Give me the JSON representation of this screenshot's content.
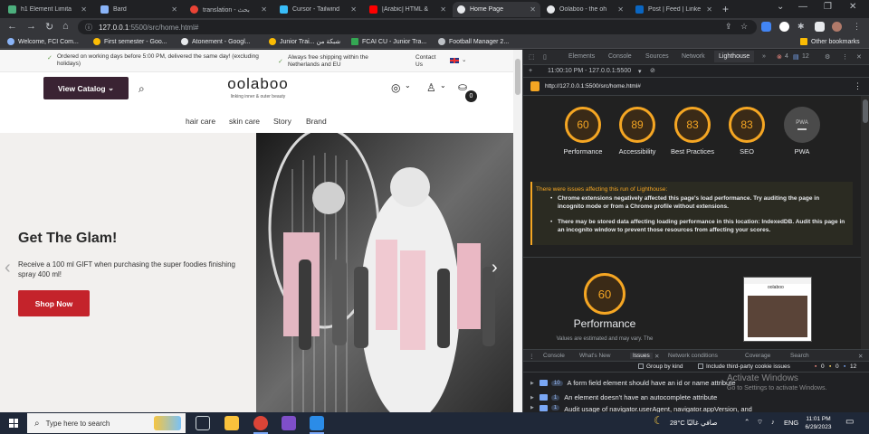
{
  "browser": {
    "tabs": [
      {
        "title": "h1 Element Limita",
        "color": "#4caf7d"
      },
      {
        "title": "Bard",
        "color": "#8ab4f8"
      },
      {
        "title": "translation - بحث",
        "color": "#ea4335"
      },
      {
        "title": "Cursor - Tailwind",
        "color": "#38bdf8"
      },
      {
        "title": "[Arabic] HTML &",
        "color": "#ff0000"
      },
      {
        "title": "Home Page",
        "color": "#e8eaed"
      },
      {
        "title": "Oolaboo - the oh",
        "color": "#e8eaed"
      },
      {
        "title": "Post | Feed | Linke",
        "color": "#0a66c2"
      }
    ],
    "url_host": "127.0.0.1",
    "url_path": ":5500/src/home.html#",
    "bookmarks": [
      {
        "label": "Welcome, FCI Com...",
        "color": "#8ab4f8"
      },
      {
        "label": "First semester - Goo...",
        "color": "#fbbc04"
      },
      {
        "label": "Atonement - Googl...",
        "color": "#e8eaed"
      },
      {
        "label": "Junior Trai... شبكة من",
        "color": "#fbbc04"
      },
      {
        "label": "FCAI CU - Junior Tra...",
        "color": "#34a853"
      },
      {
        "label": "Football Manager 2...",
        "color": "#bdc1c6"
      }
    ],
    "other_bookmarks": "Other bookmarks"
  },
  "site": {
    "notice_1": "Ordered on working days before 5:00 PM, delivered the same day! (excluding holidays)",
    "notice_2": "Always free shipping within the Netherlands and EU",
    "contact": "Contact Us",
    "catalog_button": "View Catalog",
    "logo": "oolaboo",
    "tagline": "linking inner & outer beauty",
    "cart_count": "0",
    "menu": [
      "hair care",
      "skin care",
      "Story",
      "Brand"
    ],
    "hero_title": "Get The Glam!",
    "hero_subtitle": "Receive a 100 ml GIFT when purchasing the super foodies finishing spray 400 ml!",
    "shop_button": "Shop Now"
  },
  "devtools": {
    "tabs": [
      "Elements",
      "Console",
      "Sources",
      "Network",
      "Lighthouse"
    ],
    "errors": "4",
    "warnings": "12",
    "run_time": "11:00:10 PM - 127.0.0.1:5500",
    "report_url": "http://127.0.0.1:5500/src/home.html#",
    "scores": [
      {
        "label": "Performance",
        "value": "60"
      },
      {
        "label": "Accessibility",
        "value": "89"
      },
      {
        "label": "Best Practices",
        "value": "83"
      },
      {
        "label": "SEO",
        "value": "83"
      },
      {
        "label": "PWA",
        "value": "PWA"
      }
    ],
    "warning_head": "There were issues affecting this run of Lighthouse:",
    "warning_1": "Chrome extensions negatively affected this page's load performance. Try auditing the page in incognito mode or from a Chrome profile without extensions.",
    "warning_2": "There may be stored data affecting loading performance in this location: IndexedDB. Audit this page in an incognito window to prevent those resources from affecting your scores.",
    "perf_score": "60",
    "perf_label": "Performance",
    "perf_note": "Values are estimated and may vary. The",
    "drawer_tabs": [
      "Console",
      "What's New",
      "Issues",
      "Network conditions",
      "Coverage",
      "Search"
    ],
    "group_by_kind": "Group by kind",
    "third_party": "Include third-party cookie issues",
    "issue_counts": {
      "errors": "0",
      "warnings": "0",
      "info": "12"
    },
    "issues": [
      {
        "count": "10",
        "text": "A form field element should have an id or name attribute"
      },
      {
        "count": "1",
        "text": "An element doesn't have an autocomplete attribute"
      },
      {
        "count": "1",
        "text": "Audit usage of navigator.userAgent, navigator.appVersion, and"
      }
    ]
  },
  "windows": {
    "activate_title": "Activate Windows",
    "activate_sub": "Go to Settings to activate Windows.",
    "search_placeholder": "Type here to search",
    "weather": "28°C صافي غالبًا",
    "lang": "ENG",
    "time": "11:01 PM",
    "date": "6/29/2023"
  }
}
